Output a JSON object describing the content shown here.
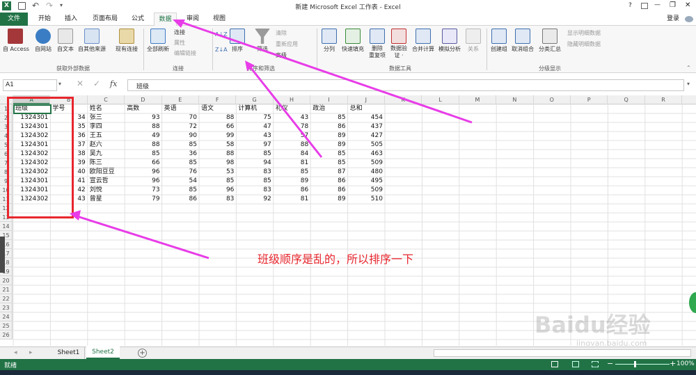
{
  "window": {
    "title": "新建 Microsoft Excel 工作表 - Excel",
    "help": "?",
    "minimize": "—",
    "restore": "❐",
    "close": "✕",
    "login": "登录"
  },
  "tabs": [
    "文件",
    "开始",
    "插入",
    "页面布局",
    "公式",
    "数据",
    "审阅",
    "视图"
  ],
  "ribbon": {
    "ext": {
      "access": "自 Access",
      "web": "自网站",
      "text": "自文本",
      "other": "自其他来源",
      "existing": "现有连接",
      "group": "获取外部数据"
    },
    "conn": {
      "refresh": "全部刷新",
      "connect": "连接",
      "props": "属性",
      "edit": "编辑链接",
      "group": "连接"
    },
    "sort": {
      "az": "A↓Z",
      "za": "Z↓A",
      "sort": "排序",
      "filter": "筛选",
      "clear": "清除",
      "reapply": "重新应用",
      "advanced": "高级",
      "group": "排序和筛选"
    },
    "tools": {
      "split": "分列",
      "flash": "快速填充",
      "dup1": "删除",
      "dup2": "重复项",
      "valid1": "数据验",
      "valid2": "证 ·",
      "consolidate": "合并计算",
      "whatif": "模拟分析",
      "relation": "关系",
      "group": "数据工具"
    },
    "outline": {
      "create": "创建组",
      "ungroup": "取消组合",
      "subtotal": "分类汇总",
      "show": "显示明细数据",
      "hide": "隐藏明细数据",
      "group": "分级显示"
    }
  },
  "formula": {
    "namebox": "A1",
    "fx": "fx",
    "value": "班级"
  },
  "columns": [
    "A",
    "B",
    "C",
    "D",
    "E",
    "F",
    "G",
    "H",
    "I",
    "J",
    "K",
    "L",
    "M",
    "N",
    "O",
    "P",
    "Q",
    "R"
  ],
  "headers": [
    "班级",
    "学号",
    "姓名",
    "高数",
    "英语",
    "语文",
    "计算机",
    "礼仪",
    "政治",
    "总和"
  ],
  "rows": [
    [
      "1324301",
      "34",
      "张三",
      "93",
      "70",
      "88",
      "75",
      "43",
      "85",
      "454"
    ],
    [
      "1324301",
      "35",
      "李四",
      "88",
      "72",
      "66",
      "47",
      "78",
      "86",
      "437"
    ],
    [
      "1324302",
      "36",
      "王五",
      "49",
      "90",
      "99",
      "43",
      "57",
      "89",
      "427"
    ],
    [
      "1324301",
      "37",
      "赵六",
      "88",
      "85",
      "58",
      "97",
      "88",
      "89",
      "505"
    ],
    [
      "1324302",
      "38",
      "吴九",
      "85",
      "36",
      "88",
      "85",
      "84",
      "85",
      "463"
    ],
    [
      "1324302",
      "39",
      "陈三",
      "66",
      "85",
      "98",
      "94",
      "81",
      "85",
      "509"
    ],
    [
      "1324302",
      "40",
      "欧阳豆豆",
      "96",
      "76",
      "53",
      "83",
      "85",
      "87",
      "480"
    ],
    [
      "1324301",
      "41",
      "宣云哲",
      "96",
      "54",
      "85",
      "85",
      "89",
      "86",
      "495"
    ],
    [
      "1324301",
      "42",
      "刘悦",
      "73",
      "85",
      "96",
      "83",
      "86",
      "86",
      "509"
    ],
    [
      "1324302",
      "43",
      "曾星",
      "79",
      "86",
      "83",
      "92",
      "81",
      "89",
      "510"
    ]
  ],
  "annotation": "班级顺序是乱的，所以排序一下",
  "sheets": [
    "Sheet1",
    "Sheet2"
  ],
  "status": {
    "ready": "就绪",
    "zoom": "100%"
  },
  "watermark": "Baidu经验",
  "watermark_url": "jingyan.baidu.com",
  "colors": {
    "excel_green": "#217346",
    "annot_red": "#e8262d",
    "arrow_magenta": "#e83ce8"
  }
}
